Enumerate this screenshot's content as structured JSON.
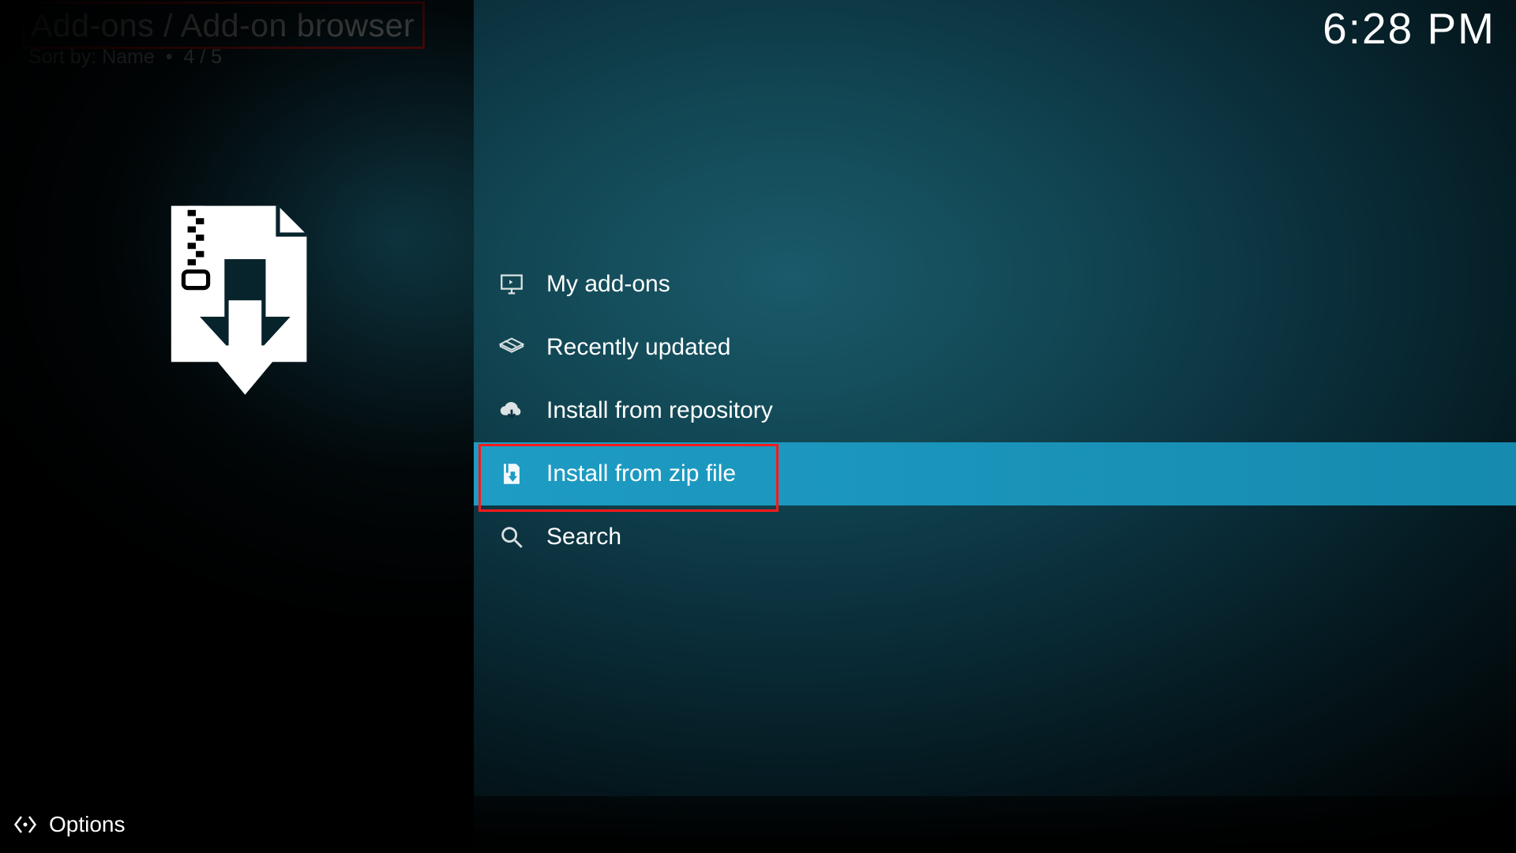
{
  "header": {
    "breadcrumb": "Add-ons / Add-on browser",
    "sort_label": "Sort by: Name",
    "sort_sep": "•",
    "position": "4 / 5",
    "clock": "6:28 PM"
  },
  "menu": {
    "items": [
      {
        "icon": "monitor-icon",
        "label": "My add-ons"
      },
      {
        "icon": "box-open-icon",
        "label": "Recently updated"
      },
      {
        "icon": "cloud-down-icon",
        "label": "Install from repository"
      },
      {
        "icon": "zip-down-icon",
        "label": "Install from zip file"
      },
      {
        "icon": "search-icon",
        "label": "Search"
      }
    ],
    "selected_index": 3
  },
  "footer": {
    "options_label": "Options"
  }
}
